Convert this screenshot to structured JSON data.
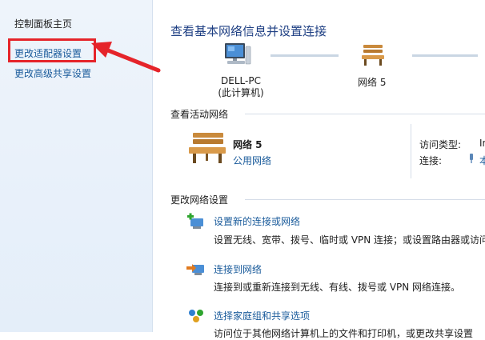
{
  "sidebar": {
    "home": "控制面板主页",
    "adapter_settings": "更改适配器设置",
    "advanced_sharing": "更改高级共享设置"
  },
  "main": {
    "title": "查看基本网络信息并设置连接",
    "map": {
      "computer_name": "DELL-PC",
      "computer_sub": "(此计算机)",
      "network_name": "网络  5"
    },
    "active_networks": {
      "heading": "查看活动网络",
      "name": "网络  5",
      "type": "公用网络",
      "access_type_label": "访问类型:",
      "access_type_value": "In",
      "connections_label": "连接:",
      "connections_value": "本"
    },
    "change_settings": {
      "heading": "更改网络设置",
      "tasks": [
        {
          "title": "设置新的连接或网络",
          "desc": "设置无线、宽带、拨号、临时或 VPN 连接；或设置路由器或访问",
          "icon": "new-connection-icon"
        },
        {
          "title": "连接到网络",
          "desc": "连接到或重新连接到无线、有线、拨号或 VPN 网络连接。",
          "icon": "connect-network-icon"
        },
        {
          "title": "选择家庭组和共享选项",
          "desc": "访问位于其他网络计算机上的文件和打印机，或更改共享设置",
          "icon": "homegroup-icon"
        }
      ]
    }
  },
  "colors": {
    "link": "#1a5b9b",
    "title": "#1e3f83",
    "highlight": "#e5242a"
  }
}
